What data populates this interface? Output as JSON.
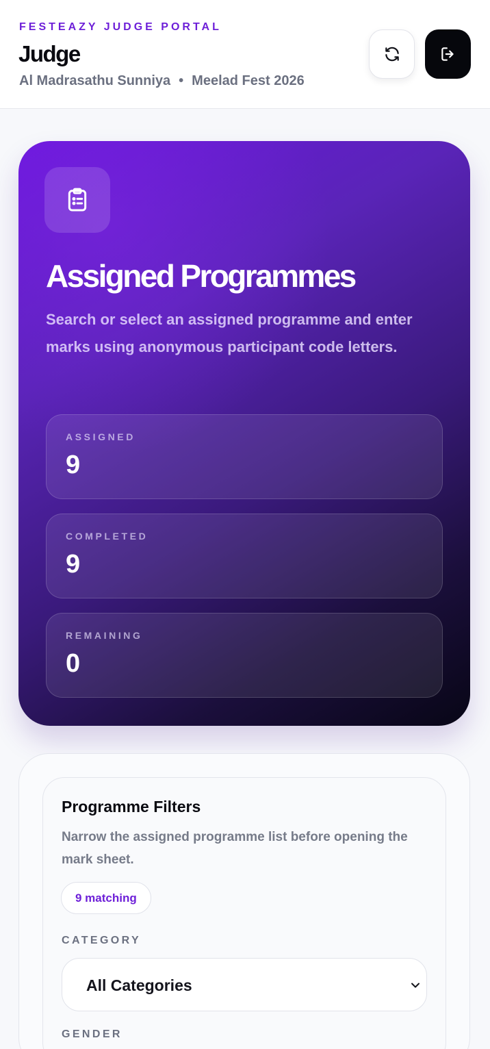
{
  "header": {
    "eyebrow": "FESTEAZY JUDGE PORTAL",
    "title": "Judge",
    "institution": "Al Madrasathu Sunniya",
    "separator": "•",
    "event": "Meelad Fest 2026",
    "refresh_icon": "refresh-icon",
    "logout_icon": "logout-icon"
  },
  "hero": {
    "icon": "clipboard-list-icon",
    "title": "Assigned Programmes",
    "description": "Search or select an assigned programme and enter marks using anonymous participant code letters.",
    "stats": [
      {
        "label": "ASSIGNED",
        "value": "9"
      },
      {
        "label": "COMPLETED",
        "value": "9"
      },
      {
        "label": "REMAINING",
        "value": "0"
      }
    ]
  },
  "filters": {
    "title": "Programme Filters",
    "description": "Narrow the assigned programme list before opening the mark sheet.",
    "match_count": "9 matching",
    "category_label": "CATEGORY",
    "category_value": "All Categories",
    "gender_label": "GENDER"
  },
  "colors": {
    "accent": "#6d1fd8",
    "hero_start": "#6b16de",
    "hero_end": "#080616",
    "logout_bg": "#06070c"
  }
}
